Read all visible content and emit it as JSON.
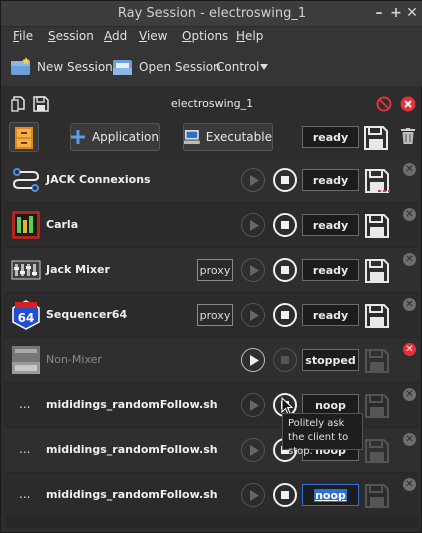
{
  "window": {
    "title": "Ray Session - electroswing_1",
    "minimize": "–",
    "maximize": "+",
    "close": "✕"
  },
  "menu": [
    {
      "label": "File",
      "u": "F",
      "rest": "ile"
    },
    {
      "label": "Session",
      "u": "S",
      "rest": "ession"
    },
    {
      "label": "Add",
      "u": "A",
      "rest": "dd"
    },
    {
      "label": "View",
      "u": "V",
      "rest": "iew"
    },
    {
      "label": "Options",
      "u": "O",
      "rest": "ptions"
    },
    {
      "label": "Help",
      "u": "H",
      "rest": "elp"
    }
  ],
  "toolbar": {
    "new_session": "New Session",
    "open_session": "Open Session",
    "control": "Control"
  },
  "session": {
    "name": "electroswing_1",
    "status": "ready"
  },
  "controls": {
    "application": "Application",
    "executable": "Executable"
  },
  "clients": [
    {
      "name": "JACK Connexions",
      "icon": "jack-connections-icon",
      "status": "ready",
      "proxy": "",
      "active": true
    },
    {
      "name": "Carla",
      "icon": "carla-icon",
      "status": "ready",
      "proxy": "",
      "active": true
    },
    {
      "name": "Jack Mixer",
      "icon": "jack-mixer-icon",
      "status": "ready",
      "proxy": "proxy",
      "active": true
    },
    {
      "name": "Sequencer64",
      "icon": "sequencer64-icon",
      "status": "ready",
      "proxy": "proxy",
      "active": true
    },
    {
      "name": "Non-Mixer",
      "icon": "non-mixer-icon",
      "status": "stopped",
      "proxy": "",
      "active": false
    },
    {
      "name": "mididings_randomFollow.sh",
      "icon": "",
      "status": "noop",
      "proxy": "",
      "active": true
    },
    {
      "name": "mididings_randomFollow.sh",
      "icon": "",
      "status": "noop",
      "proxy": "",
      "active": true
    },
    {
      "name": "mididings_randomFollow.sh",
      "icon": "",
      "status": "noop",
      "proxy": "",
      "active": true
    }
  ],
  "tooltip": {
    "text": "Politely ask the client to stop."
  },
  "colors": {
    "accent": "#2f6fd6",
    "danger": "#e5303c",
    "background": "#2d2d2d"
  }
}
